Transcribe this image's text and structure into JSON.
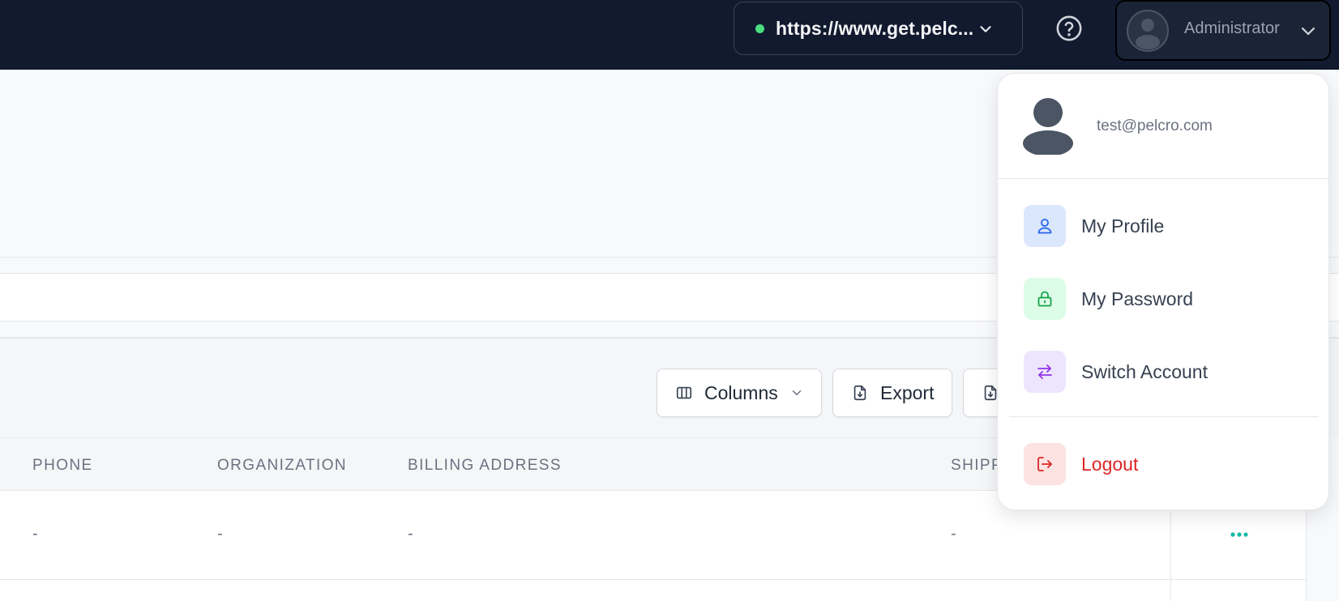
{
  "topbar": {
    "site_url": "https://www.get.pelc...",
    "user_role": "Administrator"
  },
  "toolbar": {
    "columns_label": "Columns",
    "export_label": "Export"
  },
  "table": {
    "columns": [
      "PHONE",
      "ORGANIZATION",
      "BILLING ADDRESS",
      "SHIPP"
    ],
    "rows": [
      [
        "-",
        "-",
        "-",
        "-"
      ]
    ]
  },
  "user_menu": {
    "email": "test@pelcro.com",
    "items": [
      {
        "label": "My Profile",
        "icon": "user-icon",
        "color": "#2563eb",
        "bg": "#dbe7fd"
      },
      {
        "label": "My Password",
        "icon": "lock-icon",
        "color": "#16a34a",
        "bg": "#dcfce7"
      },
      {
        "label": "Switch Account",
        "icon": "switch-arrows-icon",
        "color": "#9333ea",
        "bg": "#ede4fd"
      }
    ],
    "logout": {
      "label": "Logout",
      "icon": "logout-icon",
      "color": "#dc2626",
      "bg": "#fde2e2"
    }
  },
  "colors": {
    "topbar_bg": "#111a2e",
    "status_dot": "#4ade80",
    "action_dots": "#14b8a6"
  }
}
